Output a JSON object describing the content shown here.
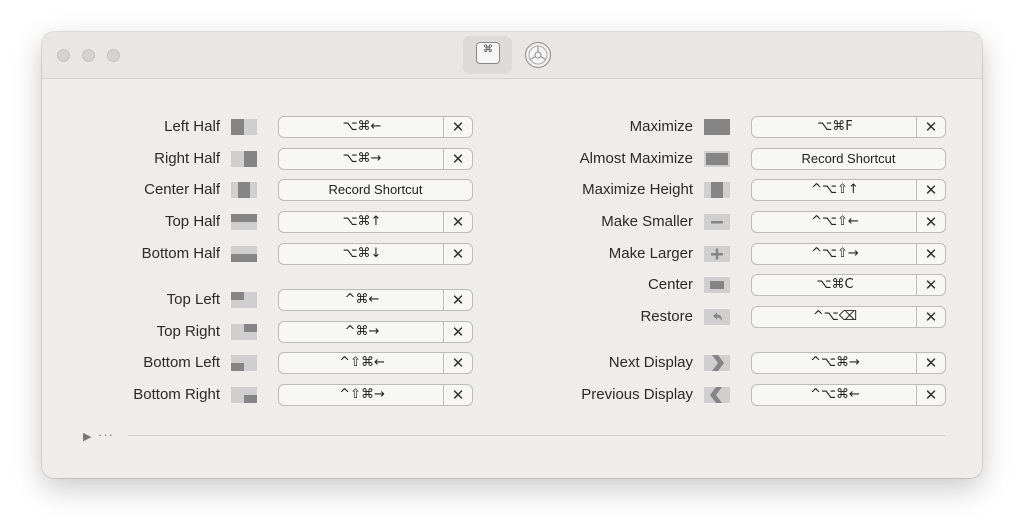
{
  "toolbar": {
    "keyboard_tab_glyph": "⌘"
  },
  "left_actions": [
    {
      "label": "Left Half",
      "keys": "⌥⌘←",
      "icon": "left-half-icon",
      "clearable": true
    },
    {
      "label": "Right Half",
      "keys": "⌥⌘→",
      "icon": "right-half-icon",
      "clearable": true
    },
    {
      "label": "Center Half",
      "keys": "Record Shortcut",
      "icon": "center-half-icon",
      "clearable": false
    },
    {
      "label": "Top Half",
      "keys": "⌥⌘↑",
      "icon": "top-half-icon",
      "clearable": true
    },
    {
      "label": "Bottom Half",
      "keys": "⌥⌘↓",
      "icon": "bottom-half-icon",
      "clearable": true
    },
    {
      "label": "Top Left",
      "keys": "^⌘←",
      "icon": "top-left-icon",
      "clearable": true
    },
    {
      "label": "Top Right",
      "keys": "^⌘→",
      "icon": "top-right-icon",
      "clearable": true
    },
    {
      "label": "Bottom Left",
      "keys": "^⇧⌘←",
      "icon": "bottom-left-icon",
      "clearable": true
    },
    {
      "label": "Bottom Right",
      "keys": "^⇧⌘→",
      "icon": "bottom-right-icon",
      "clearable": true
    }
  ],
  "right_actions": [
    {
      "label": "Maximize",
      "keys": "⌥⌘F",
      "icon": "maximize-icon",
      "clearable": true
    },
    {
      "label": "Almost Maximize",
      "keys": "Record Shortcut",
      "icon": "almost-maximize-icon",
      "clearable": false
    },
    {
      "label": "Maximize Height",
      "keys": "^⌥⇧↑",
      "icon": "maximize-height-icon",
      "clearable": true
    },
    {
      "label": "Make Smaller",
      "keys": "^⌥⇧←",
      "icon": "make-smaller-icon",
      "clearable": true
    },
    {
      "label": "Make Larger",
      "keys": "^⌥⇧→",
      "icon": "make-larger-icon",
      "clearable": true
    },
    {
      "label": "Center",
      "keys": "⌥⌘C",
      "icon": "center-icon",
      "clearable": true
    },
    {
      "label": "Restore",
      "keys": "^⌥⌫",
      "icon": "restore-icon",
      "clearable": true
    },
    {
      "label": "Next Display",
      "keys": "^⌥⌘→",
      "icon": "next-display-icon",
      "clearable": true
    },
    {
      "label": "Previous Display",
      "keys": "^⌥⌘←",
      "icon": "previous-display-icon",
      "clearable": true
    }
  ],
  "clear_glyph": "✕",
  "footer": {
    "disclosure_arrow": "▶",
    "more": "···"
  },
  "colors": {
    "window_bg": "#eeedeb",
    "icon_dark": "#858585",
    "icon_light": "#cfcfcf"
  }
}
